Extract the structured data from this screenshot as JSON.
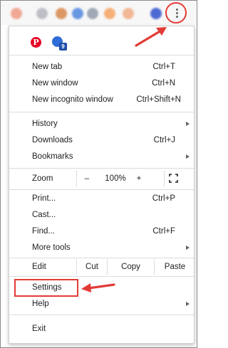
{
  "toolbar": {
    "extension_icons": [
      "extension-icon",
      "extension-icon",
      "extension-icon",
      "extension-icon",
      "extension-icon",
      "extension-icon",
      "extension-icon",
      "profile-avatar"
    ],
    "menu_button_icon": "three-dots-vertical-icon",
    "highlight_color": "#e23b36"
  },
  "menu": {
    "extensions": [
      {
        "icon": "pinterest-icon",
        "glyph": "P"
      },
      {
        "icon": "extension-icon",
        "badge": "9"
      }
    ],
    "group1": [
      {
        "label": "New tab",
        "shortcut": "Ctrl+T"
      },
      {
        "label": "New window",
        "shortcut": "Ctrl+N"
      },
      {
        "label": "New incognito window",
        "shortcut": "Ctrl+Shift+N"
      }
    ],
    "group2": [
      {
        "label": "History",
        "submenu": true
      },
      {
        "label": "Downloads",
        "shortcut": "Ctrl+J"
      },
      {
        "label": "Bookmarks",
        "submenu": true
      }
    ],
    "zoom": {
      "label": "Zoom",
      "minus": "–",
      "value": "100%",
      "plus": "+",
      "fullscreen_icon": "fullscreen-icon"
    },
    "group3": [
      {
        "label": "Print...",
        "shortcut": "Ctrl+P"
      },
      {
        "label": "Cast..."
      },
      {
        "label": "Find...",
        "shortcut": "Ctrl+F"
      },
      {
        "label": "More tools",
        "submenu": true
      }
    ],
    "edit": {
      "label": "Edit",
      "cut": "Cut",
      "copy": "Copy",
      "paste": "Paste"
    },
    "group4": [
      {
        "label": "Settings"
      },
      {
        "label": "Help",
        "submenu": true
      }
    ],
    "group5": [
      {
        "label": "Exit"
      }
    ]
  }
}
